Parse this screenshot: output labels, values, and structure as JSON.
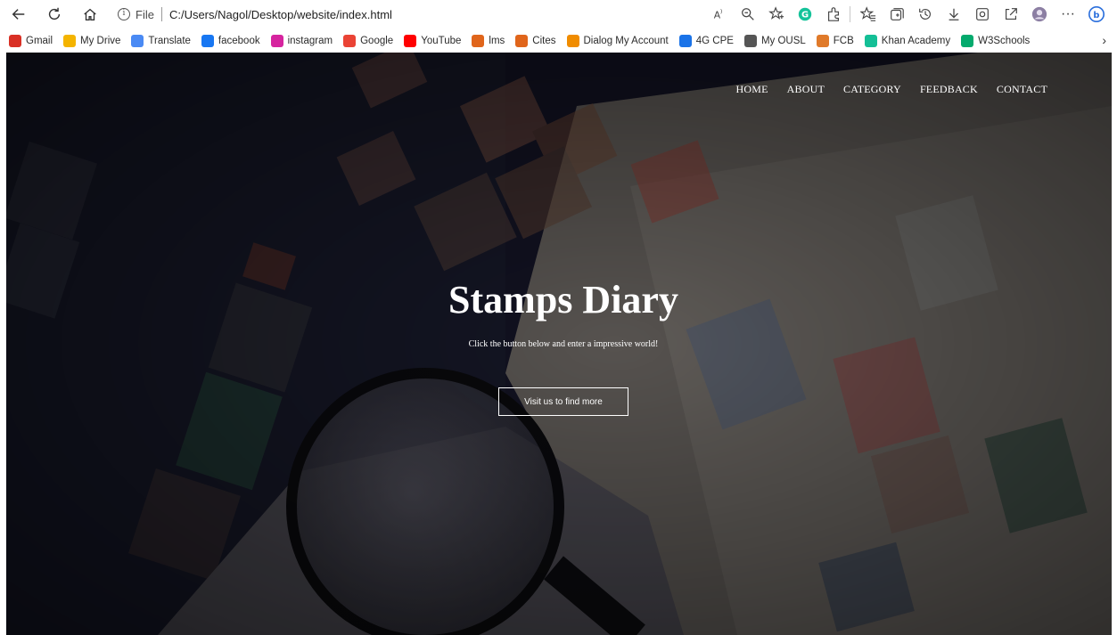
{
  "browser": {
    "address": {
      "file_label": "File",
      "url": "C:/Users/Nagol/Desktop/website/index.html"
    },
    "nav_icons": [
      "back-icon",
      "refresh-icon",
      "home-icon"
    ],
    "tool_icons": [
      "read-aloud-icon",
      "zoom-icon",
      "add-favorite-icon",
      "grammarly-icon",
      "extensions-icon",
      "favorites-icon",
      "collections-icon",
      "history-icon",
      "downloads-icon",
      "screenshot-icon",
      "share-icon",
      "profile-icon",
      "more-icon",
      "bing-icon"
    ],
    "favorites": [
      {
        "label": "Gmail",
        "icon": "gmail-icon",
        "color": "#d93025"
      },
      {
        "label": "My Drive",
        "icon": "drive-icon",
        "color": "#f4b400"
      },
      {
        "label": "Translate",
        "icon": "translate-icon",
        "color": "#4a8af4"
      },
      {
        "label": "facebook",
        "icon": "facebook-icon",
        "color": "#1877f2"
      },
      {
        "label": "instagram",
        "icon": "instagram-icon",
        "color": "#d6249f"
      },
      {
        "label": "Google",
        "icon": "google-icon",
        "color": "#ea4335"
      },
      {
        "label": "YouTube",
        "icon": "youtube-icon",
        "color": "#ff0000"
      },
      {
        "label": "lms",
        "icon": "lms-icon",
        "color": "#e0651b"
      },
      {
        "label": "Cites",
        "icon": "cites-icon",
        "color": "#e0651b"
      },
      {
        "label": "Dialog My Account",
        "icon": "dialog-icon",
        "color": "#f08c00"
      },
      {
        "label": "4G CPE",
        "icon": "cpe-icon",
        "color": "#1a73e8"
      },
      {
        "label": "My OUSL",
        "icon": "page-icon",
        "color": "#555555"
      },
      {
        "label": "FCB",
        "icon": "fcb-icon",
        "color": "#e07a2a"
      },
      {
        "label": "Khan Academy",
        "icon": "khan-icon",
        "color": "#14bf96"
      },
      {
        "label": "W3Schools",
        "icon": "w3schools-icon",
        "color": "#04aa6d"
      }
    ]
  },
  "page": {
    "nav": [
      "HOME",
      "ABOUT",
      "CATEGORY",
      "FEEDBACK",
      "CONTACT"
    ],
    "hero": {
      "title": "Stamps Diary",
      "subtitle": "Click the button below and enter a impressive world!",
      "button": "Visit us to find more"
    }
  }
}
